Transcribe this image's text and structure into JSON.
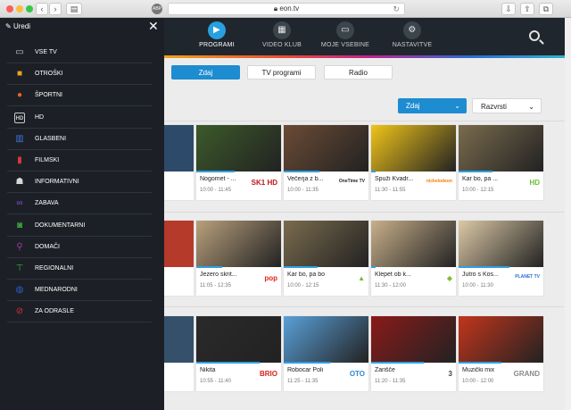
{
  "browser": {
    "url": "eon.tv",
    "back": "‹",
    "forward": "›",
    "extension_label": "ABP"
  },
  "header": {
    "nav": [
      {
        "label": "PROGRAMI",
        "icon": "tv-program-icon",
        "glyph": "▶"
      },
      {
        "label": "VIDEO KLUB",
        "icon": "film-icon",
        "glyph": "▦"
      },
      {
        "label": "MOJE VSEBINE",
        "icon": "folder-icon",
        "glyph": "▭"
      },
      {
        "label": "NASTAVITVE",
        "icon": "gear-icon",
        "glyph": "⚙"
      }
    ]
  },
  "sidemenu": {
    "edit_label": "Uredi",
    "close_glyph": "✕",
    "items": [
      {
        "label": "VSE TV",
        "icon": "tv-icon",
        "glyph": "▭",
        "color": "#c9c9c9"
      },
      {
        "label": "OTROŠKI",
        "icon": "kids-icon",
        "glyph": "■",
        "color": "#f2a21a"
      },
      {
        "label": "ŠPORTNI",
        "icon": "basketball-icon",
        "glyph": "●",
        "color": "#e8662a"
      },
      {
        "label": "HD",
        "icon": "hd-icon",
        "glyph": "HD",
        "color": "#c9c9c9"
      },
      {
        "label": "GLASBENI",
        "icon": "piano-icon",
        "glyph": "▥",
        "color": "#3e74d6"
      },
      {
        "label": "FILMSKI",
        "icon": "film-reel-icon",
        "glyph": "▮",
        "color": "#e03a36"
      },
      {
        "label": "INFORMATIVNI",
        "icon": "news-anchor-icon",
        "glyph": "☗",
        "color": "#d8d8d8"
      },
      {
        "label": "ZABAVA",
        "icon": "masks-icon",
        "glyph": "∞",
        "color": "#8a52d6"
      },
      {
        "label": "DOKUMENTARNI",
        "icon": "camera-icon",
        "glyph": "◙",
        "color": "#3caa3e"
      },
      {
        "label": "DOMAČI",
        "icon": "location-pin-icon",
        "glyph": "⚲",
        "color": "#a136a8"
      },
      {
        "label": "REGIONALNI",
        "icon": "signpost-icon",
        "glyph": "⊤",
        "color": "#3caa3e"
      },
      {
        "label": "MEDNARODNI",
        "icon": "globe-icon",
        "glyph": "◍",
        "color": "#2d5fd0"
      },
      {
        "label": "ZA ODRASLE",
        "icon": "adult-icon",
        "glyph": "⊘",
        "color": "#d83030"
      }
    ]
  },
  "tabs": [
    "Zdaj",
    "TV programi",
    "Radio"
  ],
  "filters": {
    "time": "Zdaj",
    "sort": "Razvrsti"
  },
  "rows": [
    [
      {
        "title": "Nogomet - ...",
        "time": "10:00 - 11:45",
        "logo": "SK1 HD",
        "logo_color": "#c2121c",
        "progress": 0.45,
        "thumb": "#3c5a2a"
      },
      {
        "title": "Večerja z b...",
        "time": "10:00 - 11:35",
        "logo": "OneTime TV",
        "logo_color": "#222222",
        "progress": 0.42,
        "thumb": "#6b4b35"
      },
      {
        "title": "Spuži Kvadr...",
        "time": "11:30 - 11:55",
        "logo": "nickelodeon",
        "logo_color": "#f57c00",
        "progress": 0.05,
        "thumb": "#f0c419"
      },
      {
        "title": "Kar bo, pa ...",
        "time": "10:00 - 12:15",
        "logo": "HD",
        "logo_color": "#6cbf2f",
        "progress": 0.4,
        "thumb": "#7a6b4e"
      }
    ],
    [
      {
        "title": "Jezero skrit...",
        "time": "11:05 - 12:35",
        "logo": "pop",
        "logo_color": "#e2231a",
        "progress": 0.3,
        "thumb": "#b9a07c"
      },
      {
        "title": "Kar bo, pa bo",
        "time": "10:00 - 12:15",
        "logo": "▲",
        "logo_color": "#6cbf2f",
        "progress": 0.4,
        "thumb": "#7a6b4e"
      },
      {
        "title": "Klepet ob k...",
        "time": "11:30 - 12:00",
        "logo": "◆",
        "logo_color": "#7cbf2f",
        "progress": 0.05,
        "thumb": "#c8b08a"
      },
      {
        "title": "Jutro s Kos...",
        "time": "10:00 - 11:30",
        "logo": "PLANET TV",
        "logo_color": "#2a6fd0",
        "progress": 0.6,
        "thumb": "#dcc9a6"
      }
    ],
    [
      {
        "title": "Nikita",
        "time": "10:55 - 11:40",
        "logo": "BRIO",
        "logo_color": "#d2231d",
        "progress": 0.75,
        "thumb": "#2a2a2a"
      },
      {
        "title": "Robocar Poli",
        "time": "11:25 - 11:35",
        "logo": "OTO",
        "logo_color": "#2a8ad6",
        "progress": 0.55,
        "thumb": "#5aa0d8"
      },
      {
        "title": "Žarišče",
        "time": "11:20 - 11:35",
        "logo": "3",
        "logo_color": "#444444",
        "progress": 0.62,
        "thumb": "#8a1a1a"
      },
      {
        "title": "Muzički mix",
        "time": "10:00 - 12:00",
        "logo": "GRAND",
        "logo_color": "#888888",
        "progress": 0.5,
        "thumb": "#c2351c"
      }
    ]
  ],
  "colors": {
    "accent": "#1e8cd0",
    "sidebar_bg": "#1c2026",
    "header_bg": "#20262d"
  }
}
